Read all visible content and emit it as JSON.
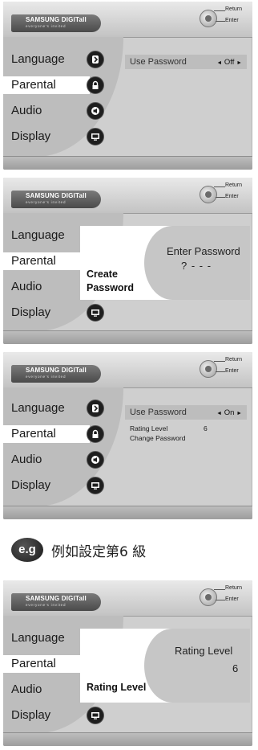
{
  "branding": {
    "logo": "SAMSUNG DIGITall",
    "tagline": "everyone's invited"
  },
  "remote": {
    "return_label": "Return",
    "enter_label": "Enter"
  },
  "menu": {
    "language": "Language",
    "parental": "Parental",
    "audio": "Audio",
    "display": "Display"
  },
  "screen1": {
    "option_label": "Use Password",
    "option_value": "Off",
    "arrow_left": "◄",
    "arrow_right": "►"
  },
  "screen2": {
    "popup_left_line1": "Create",
    "popup_left_line2": "Password",
    "popup_title": "Enter Password",
    "popup_entry": "? - - -"
  },
  "screen3": {
    "option_label": "Use Password",
    "option_value": "On",
    "arrow_left": "◄",
    "arrow_right": "►",
    "rating_label": "Rating Level",
    "rating_value": "6",
    "change_password": "Change Password"
  },
  "example": {
    "badge": "e.g",
    "caption": "例如設定第6 級"
  },
  "screen4": {
    "popup_left": "Rating Level",
    "popup_title": "Rating Level",
    "popup_value": "6"
  },
  "colors": {
    "menu_bg": "#bdbdbd",
    "panel_bg": "#cfcfcf",
    "selected_bg": "#ffffff",
    "icon_bg": "#1e1e1e"
  },
  "icons": [
    "language-icon",
    "lock-icon",
    "audio-icon",
    "display-icon",
    "remote-dial-icon"
  ]
}
